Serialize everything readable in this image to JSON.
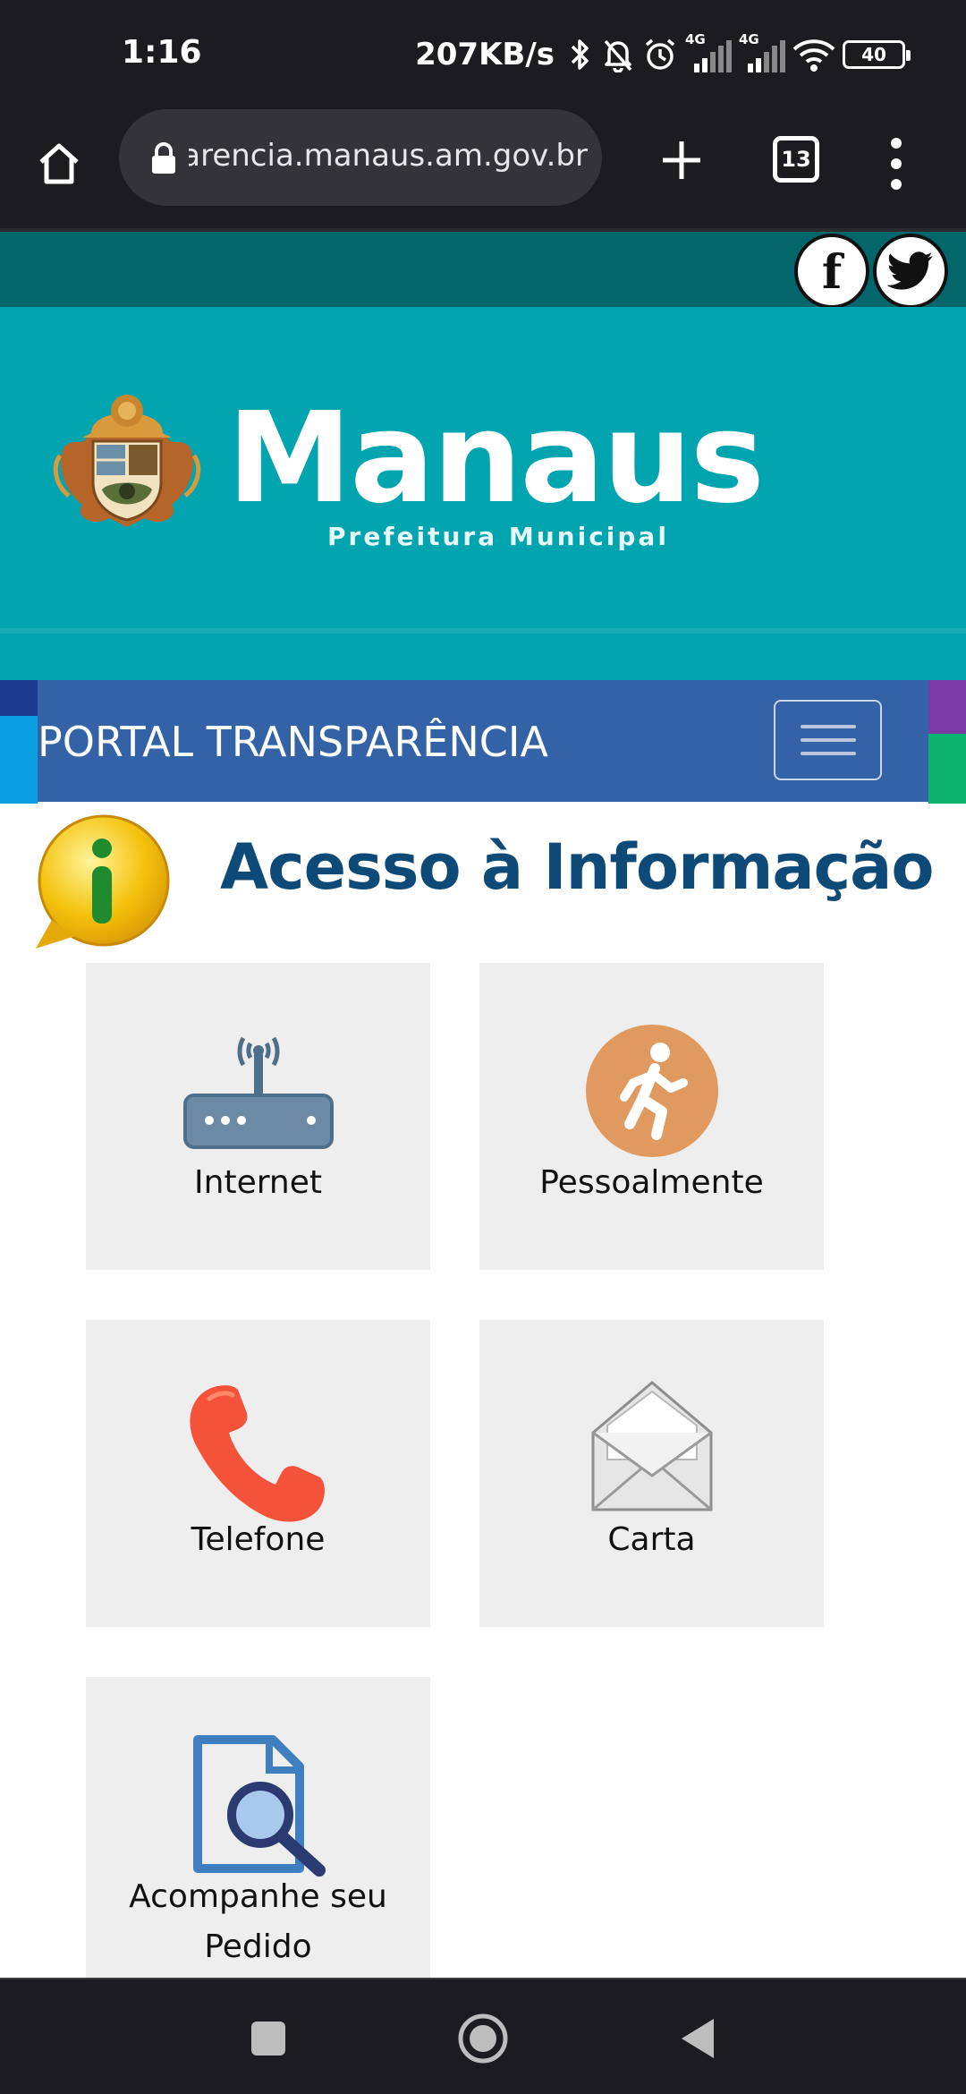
{
  "status_bar": {
    "time": "1:16",
    "speed": "207KB/s",
    "network_label_1": "4G",
    "network_label_2": "4G",
    "battery": "40"
  },
  "browser": {
    "url": "arencia.manaus.am.gov.br",
    "tab_count": "13"
  },
  "banner": {
    "brand_name": "Manaus",
    "brand_subtitle": "Prefeitura Municipal"
  },
  "nav": {
    "title": "PORTAL TRANSPARÊNCIA"
  },
  "section": {
    "title": "Acesso à Informação"
  },
  "tiles": [
    {
      "label": "Internet",
      "icon": "router-icon"
    },
    {
      "label": "Pessoalmente",
      "icon": "walking-person-icon"
    },
    {
      "label": "Telefone",
      "icon": "phone-icon"
    },
    {
      "label": "Carta",
      "icon": "envelope-icon"
    },
    {
      "label_line1": "Acompanhe seu",
      "label_line2": "Pedido",
      "icon": "document-search-icon"
    }
  ],
  "colors": {
    "banner": "#02a4b0",
    "top_strip": "#03666a",
    "nav_bar": "#3462a6",
    "section_title": "#0e4a78",
    "tile_bg": "#eeeeee"
  }
}
